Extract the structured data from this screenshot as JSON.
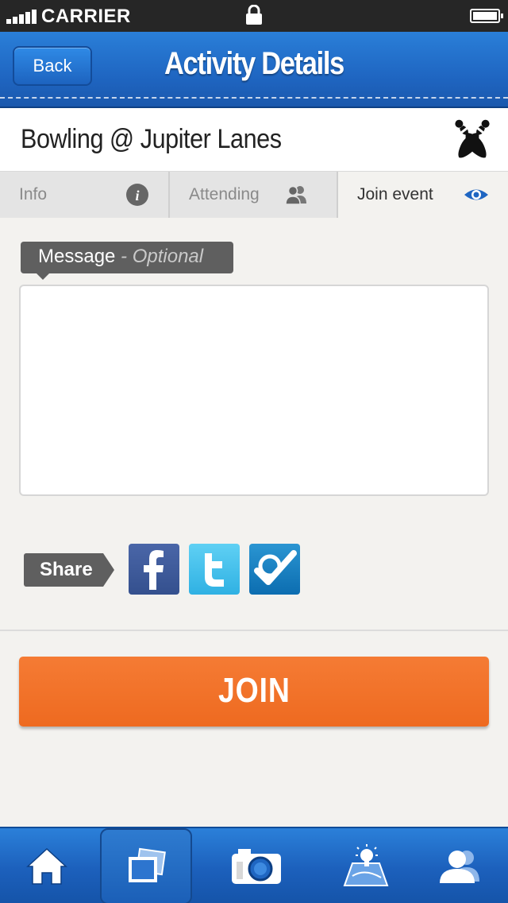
{
  "status_bar": {
    "carrier": "CARRIER",
    "icons": [
      "signal-icon",
      "lock-icon",
      "battery-icon"
    ]
  },
  "nav": {
    "back_label": "Back",
    "title": "Activity Details"
  },
  "event": {
    "title": "Bowling @ Jupiter Lanes",
    "icon": "bowling-pins-icon"
  },
  "tabs": [
    {
      "label": "Info",
      "icon": "info-icon"
    },
    {
      "label": "Attending",
      "icon": "people-icon"
    },
    {
      "label": "Join event",
      "icon": "eye-icon",
      "active": true
    }
  ],
  "message": {
    "label": "Message",
    "separator": " - ",
    "optional": "Optional",
    "value": ""
  },
  "share": {
    "label": "Share",
    "services": [
      "facebook-icon",
      "twitter-icon",
      "foursquare-icon"
    ]
  },
  "join_label": "JOIN",
  "tab_bar": {
    "items": [
      "home-icon",
      "photos-icon",
      "camera-icon",
      "map-icon",
      "profile-icon"
    ],
    "selected": "photos-icon"
  },
  "colors": {
    "brand_blue": "#1f66c2",
    "join_orange": "#f1702a",
    "label_gray": "#5f5f5f"
  }
}
